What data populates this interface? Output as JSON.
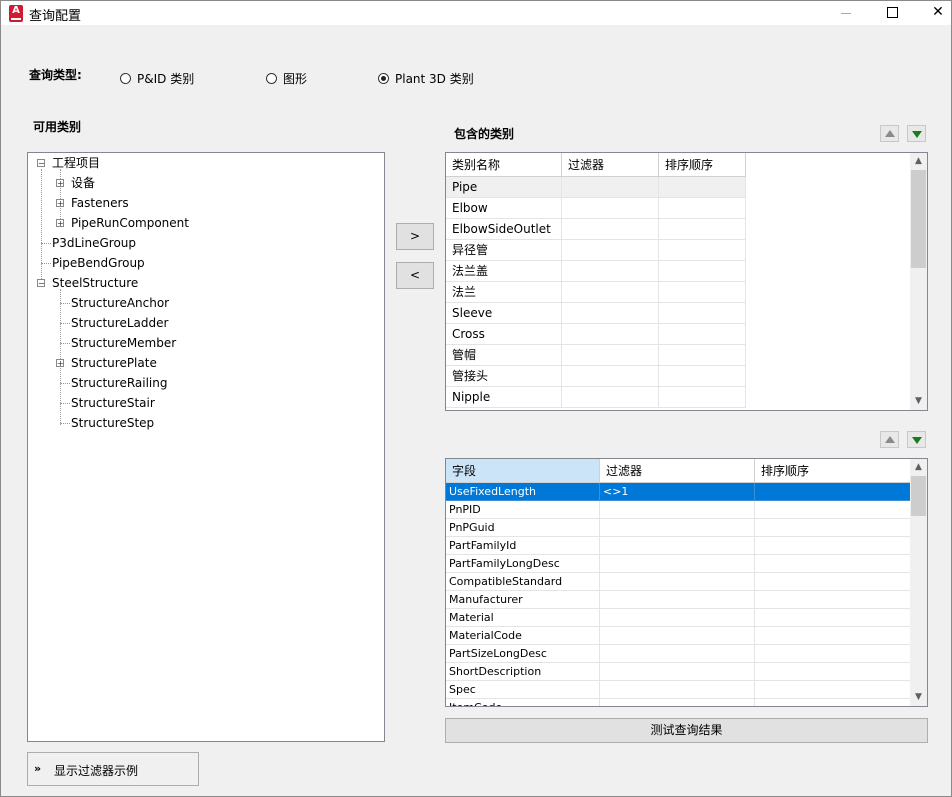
{
  "window": {
    "title": "查询配置",
    "icon": "autocad-plant-icon"
  },
  "query_type": {
    "label": "查询类型:",
    "options": [
      {
        "label": "P&ID 类别",
        "selected": false
      },
      {
        "label": "图形",
        "selected": false
      },
      {
        "label": "Plant 3D 类别",
        "selected": true
      }
    ]
  },
  "available": {
    "label": "可用类别",
    "tree": [
      {
        "label": "工程项目",
        "expander": "-"
      },
      {
        "label": "设备",
        "expander": "+"
      },
      {
        "label": "Fasteners",
        "expander": "+"
      },
      {
        "label": "PipeRunComponent",
        "expander": "+"
      },
      {
        "label": "P3dLineGroup",
        "expander": ""
      },
      {
        "label": "PipeBendGroup",
        "expander": ""
      },
      {
        "label": "SteelStructure",
        "expander": "-"
      },
      {
        "label": "StructureAnchor",
        "expander": ""
      },
      {
        "label": "StructureLadder",
        "expander": ""
      },
      {
        "label": "StructureMember",
        "expander": ""
      },
      {
        "label": "StructurePlate",
        "expander": "+"
      },
      {
        "label": "StructureRailing",
        "expander": ""
      },
      {
        "label": "StructureStair",
        "expander": ""
      },
      {
        "label": "StructureStep",
        "expander": ""
      }
    ]
  },
  "move_buttons": {
    "add": ">",
    "remove": "<"
  },
  "included": {
    "label": "包含的类别",
    "columns": [
      "类别名称",
      "过滤器",
      "排序顺序"
    ],
    "rows": [
      "Pipe",
      "Elbow",
      "ElbowSideOutlet",
      "异径管",
      "法兰盖",
      "法兰",
      "Sleeve",
      "Cross",
      "管帽",
      "管接头",
      "Nipple"
    ],
    "selected_index": 0
  },
  "fields": {
    "columns": [
      "字段",
      "过滤器",
      "排序顺序"
    ],
    "rows": [
      {
        "field": "UseFixedLength",
        "filter": "<>1",
        "sort": ""
      },
      {
        "field": "PnPID",
        "filter": "",
        "sort": ""
      },
      {
        "field": "PnPGuid",
        "filter": "",
        "sort": ""
      },
      {
        "field": "PartFamilyId",
        "filter": "",
        "sort": ""
      },
      {
        "field": "PartFamilyLongDesc",
        "filter": "",
        "sort": ""
      },
      {
        "field": "CompatibleStandard",
        "filter": "",
        "sort": ""
      },
      {
        "field": "Manufacturer",
        "filter": "",
        "sort": ""
      },
      {
        "field": "Material",
        "filter": "",
        "sort": ""
      },
      {
        "field": "MaterialCode",
        "filter": "",
        "sort": ""
      },
      {
        "field": "PartSizeLongDesc",
        "filter": "",
        "sort": ""
      },
      {
        "field": "ShortDescription",
        "filter": "",
        "sort": ""
      },
      {
        "field": "Spec",
        "filter": "",
        "sort": ""
      },
      {
        "field": "ItemCode",
        "filter": "",
        "sort": ""
      }
    ],
    "selected_index": 0
  },
  "test_button": "测试查询结果",
  "filter_example_button": "显示过滤器示例",
  "colors": {
    "selection": "#0078d7",
    "header_selected": "#cce4f7",
    "row_highlight": "#f0f0f0"
  }
}
